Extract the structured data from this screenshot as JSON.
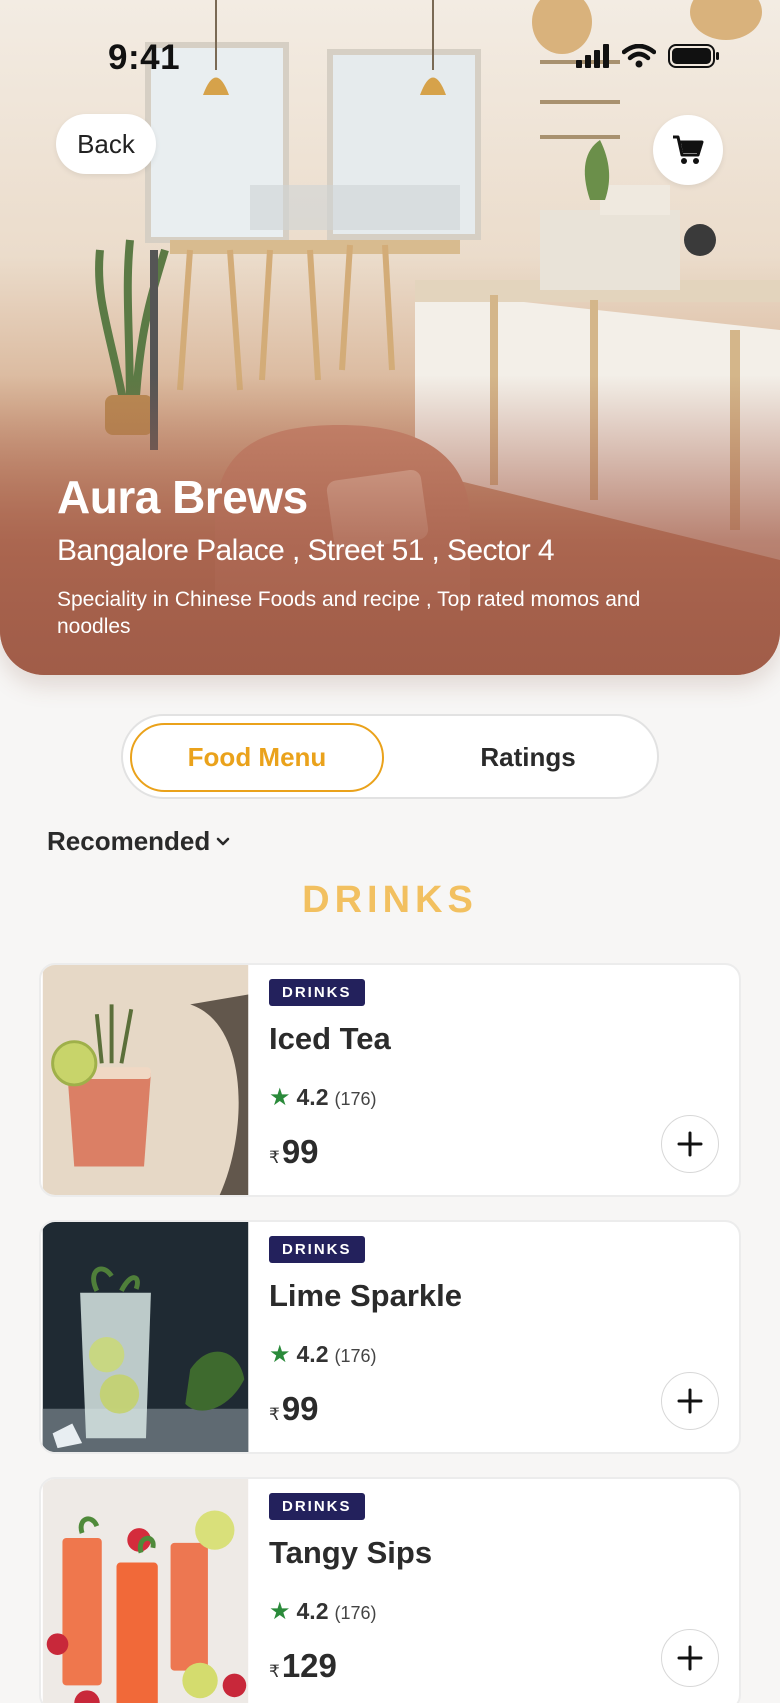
{
  "status_bar": {
    "time": "9:41"
  },
  "header": {
    "back_label": "Back",
    "restaurant_name": "Aura Brews",
    "address": "Bangalore Palace , Street 51 , Sector 4",
    "description": "Speciality in Chinese Foods and recipe , Top rated momos and noodles"
  },
  "tabs": [
    {
      "label": "Food Menu",
      "active": true
    },
    {
      "label": "Ratings",
      "active": false
    }
  ],
  "sort": {
    "label": "Recomended"
  },
  "section": {
    "title": "DRINKS"
  },
  "items": [
    {
      "badge": "DRINKS",
      "name": "Iced Tea",
      "rating": "4.2",
      "rating_count": "(176)",
      "currency": "₹",
      "price": "99"
    },
    {
      "badge": "DRINKS",
      "name": "Lime Sparkle",
      "rating": "4.2",
      "rating_count": "(176)",
      "currency": "₹",
      "price": "99"
    },
    {
      "badge": "DRINKS",
      "name": "Tangy Sips",
      "rating": "4.2",
      "rating_count": "(176)",
      "currency": "₹",
      "price": "129"
    }
  ],
  "colors": {
    "accent": "#eaa21b",
    "section_title": "#f2c060",
    "badge_bg": "#23215c",
    "star": "#2a8a3a",
    "hero_overlay": "#a9654d"
  }
}
